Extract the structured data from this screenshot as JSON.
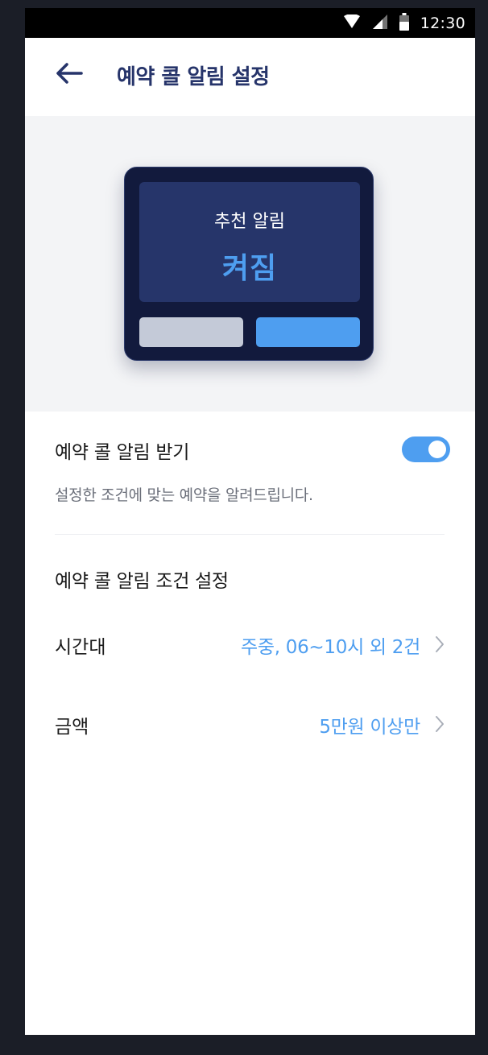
{
  "status_bar": {
    "time": "12:30",
    "icons": [
      "wifi-icon",
      "signal-icon",
      "battery-icon"
    ]
  },
  "header": {
    "back_icon": "arrow-left-icon",
    "title": "예약 콜 알림 설정"
  },
  "preview": {
    "label": "추천 알림",
    "state": "켜짐"
  },
  "notification": {
    "title": "예약 콜 알림 받기",
    "enabled": true,
    "description": "설정한 조건에 맞는 예약을 알려드립니다."
  },
  "conditions": {
    "title": "예약 콜 알림 조건 설정",
    "items": [
      {
        "label": "시간대",
        "value": "주중, 06~10시 외 2건"
      },
      {
        "label": "금액",
        "value": "5만원 이상만"
      }
    ]
  },
  "colors": {
    "accent": "#4e9ef0",
    "title": "#26346a",
    "device_bg": "#121a3d",
    "device_screen": "#26356a",
    "hero_bg": "#f3f4f6"
  }
}
